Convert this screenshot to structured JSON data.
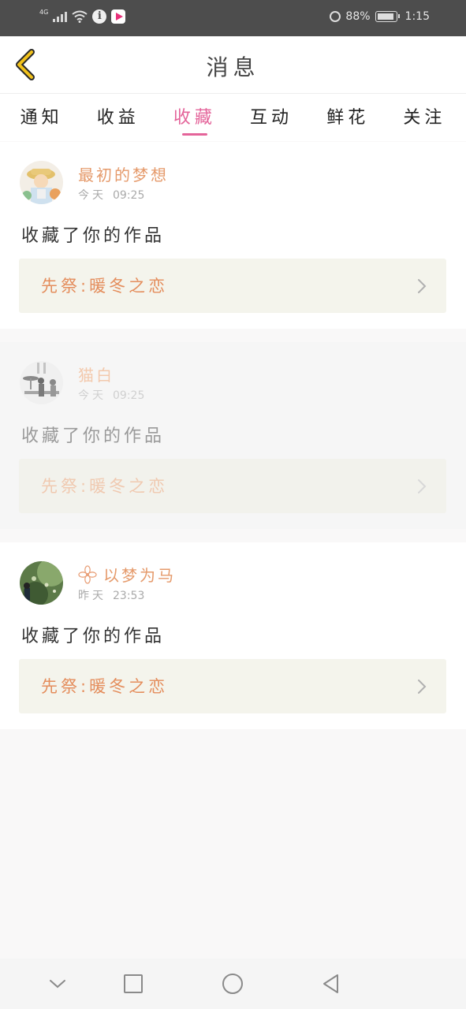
{
  "status_bar": {
    "network": "4G",
    "battery": "88%",
    "time": "1:15",
    "icons": [
      "signal-icon",
      "wifi-icon",
      "info-icon",
      "app-notification-icon",
      "alarm-icon",
      "battery-icon"
    ]
  },
  "header": {
    "title": "消息",
    "back_icon": "chevron-left-icon",
    "accent": "#f2c21b"
  },
  "tabs": [
    {
      "label": "通知",
      "active": false
    },
    {
      "label": "收益",
      "active": false
    },
    {
      "label": "收藏",
      "active": true
    },
    {
      "label": "互动",
      "active": false
    },
    {
      "label": "鲜花",
      "active": false
    },
    {
      "label": "关注",
      "active": false
    }
  ],
  "colors": {
    "tab_active": "#e4649a",
    "username": "#e59a6b",
    "work_title": "#e48d5c",
    "work_box_bg": "#f4f4ec"
  },
  "messages": [
    {
      "user": "最初的梦想",
      "day": "今天",
      "time": "09:25",
      "action": "收藏了你的作品",
      "work": "先祭:暖冬之恋",
      "faded": false
    },
    {
      "user": "猫白",
      "day": "今天",
      "time": "09:25",
      "action": "收藏了你的作品",
      "work": "先祭:暖冬之恋",
      "faded": true
    },
    {
      "user": "以梦为马",
      "day": "昨天",
      "time": "23:53",
      "action": "收藏了你的作品",
      "work": "先祭:暖冬之恋",
      "faded": false,
      "badge_icon": "flower-icon"
    }
  ],
  "nav_bar": {
    "icons": [
      "chevron-down-icon",
      "recents-square-icon",
      "home-circle-icon",
      "back-triangle-icon"
    ]
  }
}
